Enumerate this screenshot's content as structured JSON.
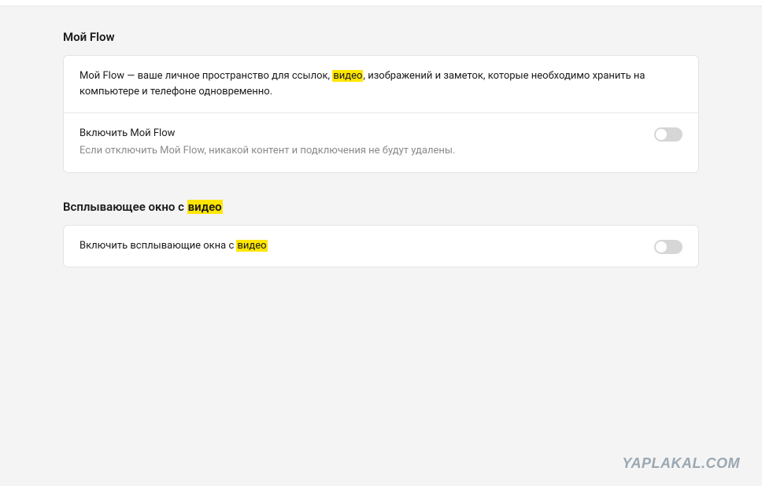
{
  "sections": {
    "myFlow": {
      "title": "Мой Flow",
      "desc_prefix": "Мой Flow — ваше личное пространство для ссылок, ",
      "desc_highlight": "видео",
      "desc_suffix": ", изображений и заметок, которые необходимо хранить на компьютере и телефоне одновременно.",
      "toggle_label": "Включить Мой Flow",
      "toggle_sub": "Если отключить Мой Flow, никакой контент и подключения не будут удалены."
    },
    "videoPopup": {
      "title_prefix": "Всплывающее окно с ",
      "title_highlight": "видео",
      "toggle_label_prefix": "Включить всплывающие окна с ",
      "toggle_label_highlight": "видео"
    }
  },
  "watermark": "YAPLAKAL.COM"
}
